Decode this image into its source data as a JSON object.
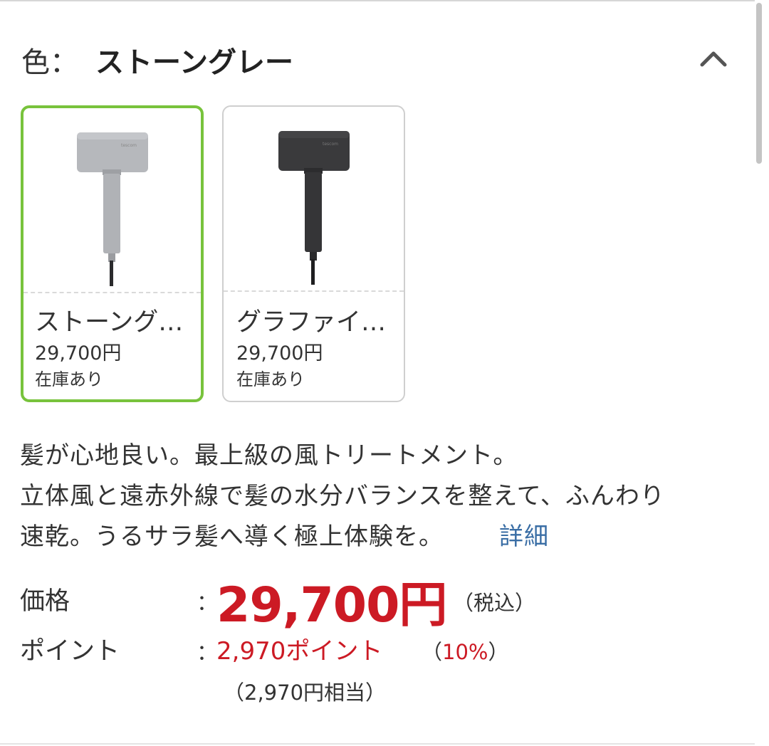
{
  "header": {
    "color_label": "色：",
    "color_value": "ストーングレー"
  },
  "swatches": [
    {
      "name": "ストーング…",
      "price": "29,700円",
      "stock": "在庫あり",
      "selected": true,
      "body_color": "#b6b8bc",
      "image_icon": "hair-dryer-gray"
    },
    {
      "name": "グラファイ…",
      "price": "29,700円",
      "stock": "在庫あり",
      "selected": false,
      "body_color": "#3a3a3c",
      "image_icon": "hair-dryer-black"
    }
  ],
  "description": {
    "line1": "髪が心地良い。最上級の風トリートメント。",
    "line2": "立体風と遠赤外線で髪の水分バランスを整えて、ふんわり",
    "line3": "速乾。うるサラ髪へ導く極上体験を。",
    "detail_link": "詳細"
  },
  "pricing": {
    "price_label": "価格",
    "colon": "：",
    "price_value": "29,700円",
    "tax_note": "（税込）",
    "points_label": "ポイント",
    "points_value": "2,970ポイント",
    "points_pct_open": "（",
    "points_pct": "10%",
    "points_pct_close": "）",
    "points_equivalent": "（2,970円相当）"
  },
  "colors": {
    "accent_selected": "#78c33c",
    "price_red": "#cc1a24",
    "link_blue": "#3a6ea5"
  }
}
